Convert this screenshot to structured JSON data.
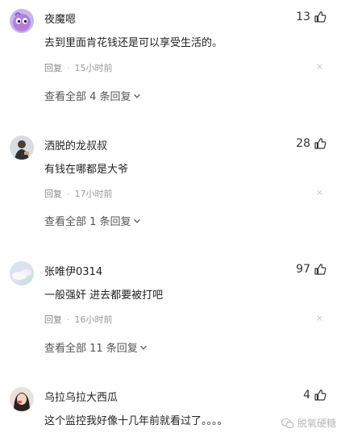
{
  "comments": [
    {
      "username": "夜魔嗯",
      "likes": "13",
      "content": "去到里面肯花钱还是可以享受生活的。",
      "reply_label": "回复",
      "dot": "·",
      "time": "15小时前",
      "close": "×",
      "view_all": "查看全部 4 条回复",
      "avatar_icon": "purple-cartoon-avatar-icon"
    },
    {
      "username": "洒脱的龙叔叔",
      "likes": "28",
      "content": "有钱在哪都是大爷",
      "reply_label": "回复",
      "dot": "·",
      "time": "17小时前",
      "close": "×",
      "view_all": "查看全部 1 条回复",
      "avatar_icon": "person-photo-avatar-icon"
    },
    {
      "username": "张唯伊0314",
      "likes": "97",
      "content": "一般强奸 进去都要被打吧",
      "reply_label": "回复",
      "dot": "·",
      "time": "16小时前",
      "close": "×",
      "view_all": "查看全部 11 条回复",
      "avatar_icon": "pastel-cloud-avatar-icon"
    },
    {
      "username": "乌拉乌拉大西瓜",
      "likes": "4",
      "content": "这个监控我好像十几年前就看过了。。。。",
      "avatar_icon": "woman-photo-avatar-icon"
    }
  ],
  "watermark": {
    "text": "脱氧硬糖",
    "icon": "wechat-icon"
  },
  "colors": {
    "text": "#222222",
    "meta": "#999999",
    "view_all": "#555555"
  }
}
